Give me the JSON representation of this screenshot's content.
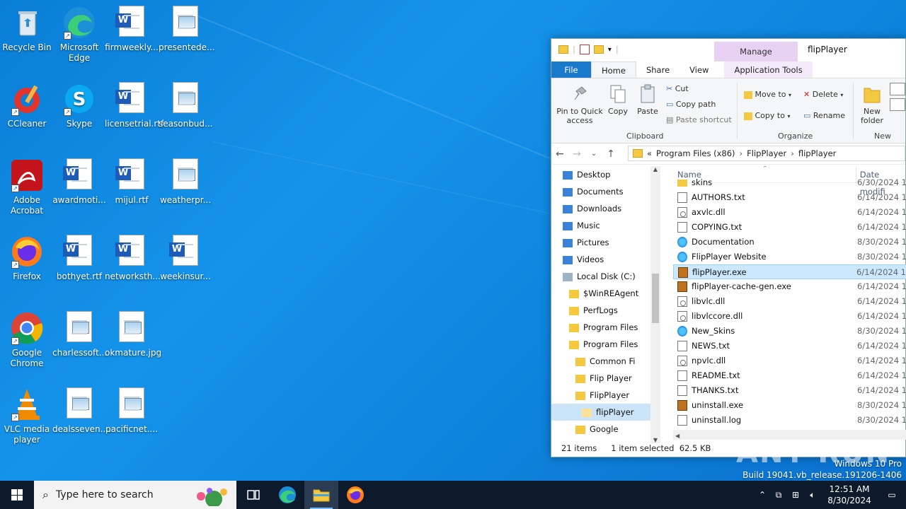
{
  "desktop": {
    "icons": [
      {
        "label": "Recycle Bin"
      },
      {
        "label": "Microsoft Edge"
      },
      {
        "label": "firmweekly..."
      },
      {
        "label": "presentede..."
      },
      {
        "label": "CCleaner"
      },
      {
        "label": "Skype"
      },
      {
        "label": "licensetrial.rtf"
      },
      {
        "label": "seasonbud..."
      },
      {
        "label": "Adobe Acrobat"
      },
      {
        "label": "awardmoti..."
      },
      {
        "label": "mijul.rtf"
      },
      {
        "label": "weatherpr..."
      },
      {
        "label": "Firefox"
      },
      {
        "label": "bothyet.rtf"
      },
      {
        "label": "networksth..."
      },
      {
        "label": "weekinsur..."
      },
      {
        "label": "Google Chrome"
      },
      {
        "label": "charlessoft..."
      },
      {
        "label": "okmature.jpg"
      },
      {
        "label": "VLC media player"
      },
      {
        "label": "dealsseven...."
      },
      {
        "label": "pacificnet...."
      }
    ]
  },
  "explorer": {
    "title": "flipPlayer",
    "manage_label": "Manage",
    "tabs": [
      "File",
      "Home",
      "Share",
      "View",
      "Application Tools"
    ],
    "ribbon": {
      "pin": "Pin to Quick access",
      "copy": "Copy",
      "paste": "Paste",
      "cut": "Cut",
      "copy_path": "Copy path",
      "paste_shortcut": "Paste shortcut",
      "clipboard_group": "Clipboard",
      "move_to": "Move to",
      "copy_to": "Copy to",
      "delete": "Delete",
      "rename": "Rename",
      "organize_group": "Organize",
      "new_folder": "New folder",
      "new_group": "New"
    },
    "address": {
      "overflow": "«",
      "crumbs": [
        "Program Files (x86)",
        "FlipPlayer",
        "flipPlayer"
      ]
    },
    "nav": [
      {
        "label": "Desktop",
        "indent": 1
      },
      {
        "label": "Documents",
        "indent": 1
      },
      {
        "label": "Downloads",
        "indent": 1
      },
      {
        "label": "Music",
        "indent": 1
      },
      {
        "label": "Pictures",
        "indent": 1
      },
      {
        "label": "Videos",
        "indent": 1
      },
      {
        "label": "Local Disk (C:)",
        "indent": 1
      },
      {
        "label": "$WinREAgent",
        "indent": 2
      },
      {
        "label": "PerfLogs",
        "indent": 2
      },
      {
        "label": "Program Files",
        "indent": 2
      },
      {
        "label": "Program Files",
        "indent": 2
      },
      {
        "label": "Common Fi",
        "indent": 3
      },
      {
        "label": "Flip Player",
        "indent": 3
      },
      {
        "label": "FlipPlayer",
        "indent": 3
      },
      {
        "label": "flipPlayer",
        "indent": 4,
        "selected": true
      },
      {
        "label": "Google",
        "indent": 3
      }
    ],
    "columns": {
      "name": "Name",
      "date": "Date modifi"
    },
    "files": [
      {
        "name": "skins",
        "date": "6/30/2024 1",
        "type": "folder"
      },
      {
        "name": "AUTHORS.txt",
        "date": "6/14/2024 1",
        "type": "txt"
      },
      {
        "name": "axvlc.dll",
        "date": "6/14/2024 1",
        "type": "dll"
      },
      {
        "name": "COPYING.txt",
        "date": "6/14/2024 1",
        "type": "txt"
      },
      {
        "name": "Documentation",
        "date": "8/30/2024 1",
        "type": "web"
      },
      {
        "name": "FlipPlayer Website",
        "date": "8/30/2024 1",
        "type": "web"
      },
      {
        "name": "flipPlayer.exe",
        "date": "6/14/2024 1",
        "type": "exe",
        "selected": true
      },
      {
        "name": "flipPlayer-cache-gen.exe",
        "date": "6/14/2024 1",
        "type": "exe"
      },
      {
        "name": "libvlc.dll",
        "date": "6/14/2024 1",
        "type": "dll"
      },
      {
        "name": "libvlccore.dll",
        "date": "6/14/2024 1",
        "type": "dll"
      },
      {
        "name": "New_Skins",
        "date": "8/30/2024 1",
        "type": "web"
      },
      {
        "name": "NEWS.txt",
        "date": "6/14/2024 1",
        "type": "txt"
      },
      {
        "name": "npvlc.dll",
        "date": "6/14/2024 1",
        "type": "dll"
      },
      {
        "name": "README.txt",
        "date": "6/14/2024 1",
        "type": "txt"
      },
      {
        "name": "THANKS.txt",
        "date": "6/14/2024 1",
        "type": "txt"
      },
      {
        "name": "uninstall.exe",
        "date": "8/30/2024 1",
        "type": "exe"
      },
      {
        "name": "uninstall.log",
        "date": "8/30/2024 1",
        "type": "txt"
      }
    ],
    "status": {
      "count": "21 items",
      "selected": "1 item selected",
      "size": "62.5 KB"
    }
  },
  "watermark": "ANY RUN",
  "windows_info": {
    "edition": "Windows 10 Pro",
    "build": "Build 19041.vb_release.191206-1406"
  },
  "taskbar": {
    "search_placeholder": "Type here to search",
    "time": "12:51 AM",
    "date": "8/30/2024"
  }
}
